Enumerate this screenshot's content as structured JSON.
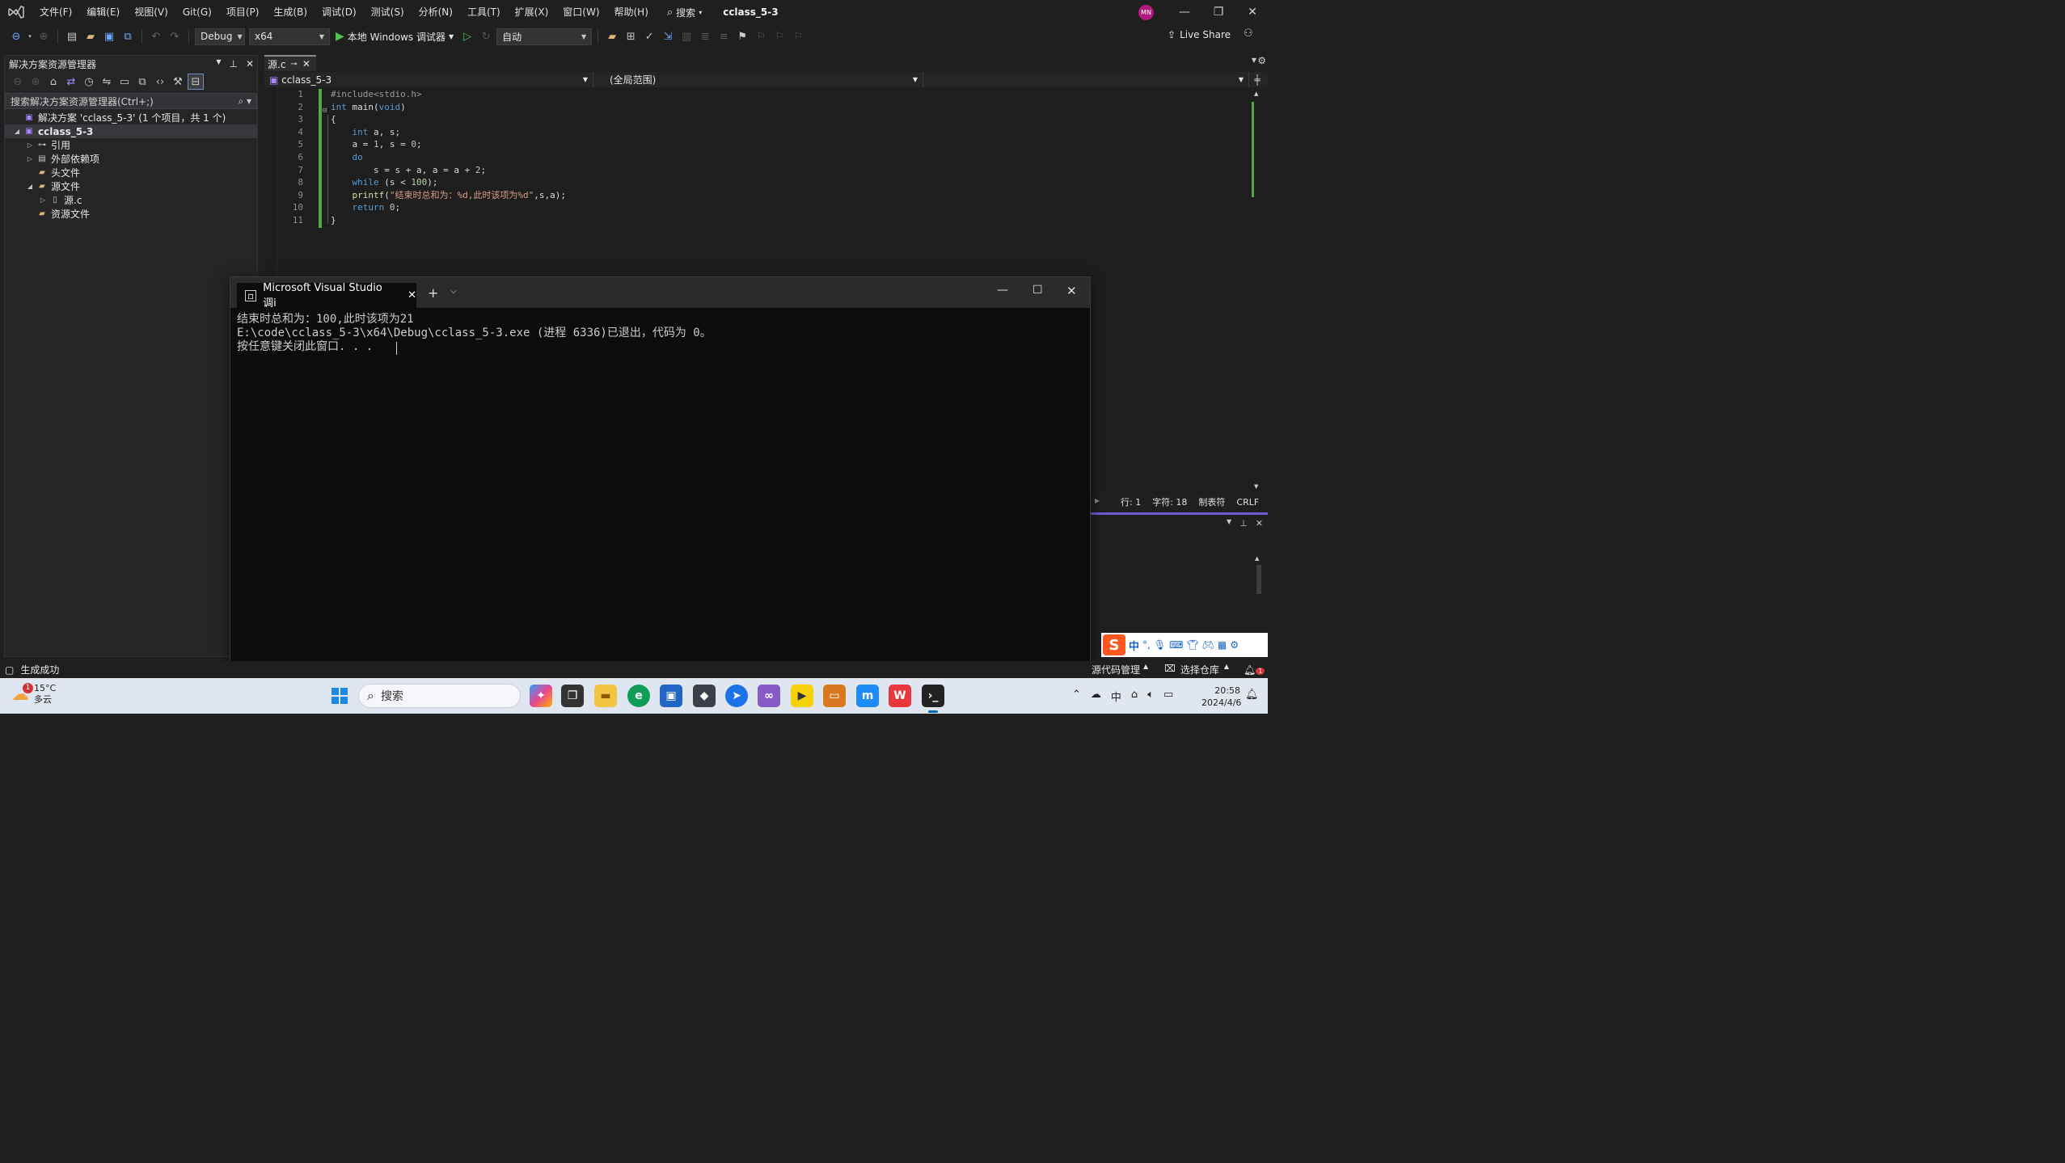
{
  "titlebar": {
    "menus": [
      "文件(F)",
      "编辑(E)",
      "视图(V)",
      "Git(G)",
      "项目(P)",
      "生成(B)",
      "调试(D)",
      "测试(S)",
      "分析(N)",
      "工具(T)",
      "扩展(X)",
      "窗口(W)",
      "帮助(H)"
    ],
    "search_label": "搜索",
    "solution_name": "cclass_5-3",
    "avatar_initials": "MN",
    "avatar_color": "#b0197e"
  },
  "toolbar": {
    "config": "Debug",
    "platform": "x64",
    "run_label": "本地 Windows 调试器",
    "auto": "自动",
    "live_share": "Live Share",
    "run_color": "#4ec24e"
  },
  "explorer": {
    "title": "解决方案资源管理器",
    "search_placeholder": "搜索解决方案资源管理器(Ctrl+;)",
    "tree": [
      {
        "label": "解决方案 'cclass_5-3' (1 个项目，共 1 个)",
        "level": 0,
        "expander": "",
        "icon": "solution-icon"
      },
      {
        "label": "cclass_5-3",
        "level": 0,
        "expander": "◢",
        "icon": "project-icon",
        "bold": true,
        "selected": true
      },
      {
        "label": "引用",
        "level": 1,
        "expander": "▷",
        "icon": "references-icon"
      },
      {
        "label": "外部依赖项",
        "level": 1,
        "expander": "▷",
        "icon": "external-deps-icon"
      },
      {
        "label": "头文件",
        "level": 1,
        "expander": "",
        "icon": "folder-icon"
      },
      {
        "label": "源文件",
        "level": 1,
        "expander": "◢",
        "icon": "folder-icon"
      },
      {
        "label": "源.c",
        "level": 2,
        "expander": "▷",
        "icon": "c-file-icon"
      },
      {
        "label": "资源文件",
        "level": 1,
        "expander": "",
        "icon": "folder-icon"
      }
    ]
  },
  "editor": {
    "tab_name": "源.c",
    "nav_project": "cclass_5-3",
    "nav_scope": "(全局范围)",
    "lines": [
      {
        "n": "1",
        "parts": [
          {
            "c": "pp",
            "t": "#include<stdio.h>"
          }
        ]
      },
      {
        "n": "2",
        "parts": [
          {
            "c": "kw",
            "t": "int"
          },
          {
            "c": "txt",
            "t": " main("
          },
          {
            "c": "kw",
            "t": "void"
          },
          {
            "c": "txt",
            "t": ")"
          }
        ]
      },
      {
        "n": "3",
        "parts": [
          {
            "c": "txt",
            "t": "{"
          }
        ]
      },
      {
        "n": "4",
        "parts": [
          {
            "c": "txt",
            "t": "    "
          },
          {
            "c": "kw",
            "t": "int"
          },
          {
            "c": "txt",
            "t": " a, s;"
          }
        ]
      },
      {
        "n": "5",
        "parts": [
          {
            "c": "txt",
            "t": "    a = "
          },
          {
            "c": "num",
            "t": "1"
          },
          {
            "c": "txt",
            "t": ", s = "
          },
          {
            "c": "num",
            "t": "0"
          },
          {
            "c": "txt",
            "t": ";"
          }
        ]
      },
      {
        "n": "6",
        "parts": [
          {
            "c": "txt",
            "t": "    "
          },
          {
            "c": "kw",
            "t": "do"
          }
        ]
      },
      {
        "n": "7",
        "parts": [
          {
            "c": "txt",
            "t": "        s = s + a, a = a + "
          },
          {
            "c": "num",
            "t": "2"
          },
          {
            "c": "txt",
            "t": ";"
          }
        ]
      },
      {
        "n": "8",
        "parts": [
          {
            "c": "txt",
            "t": "    "
          },
          {
            "c": "kw",
            "t": "while"
          },
          {
            "c": "txt",
            "t": " (s < "
          },
          {
            "c": "num",
            "t": "100"
          },
          {
            "c": "txt",
            "t": ");"
          }
        ]
      },
      {
        "n": "9",
        "parts": [
          {
            "c": "txt",
            "t": "    "
          },
          {
            "c": "fn",
            "t": "printf"
          },
          {
            "c": "txt",
            "t": "("
          },
          {
            "c": "str",
            "t": "\"结束时总和为：%d,此时该项为%d\""
          },
          {
            "c": "txt",
            "t": ",s,a);"
          }
        ]
      },
      {
        "n": "10",
        "parts": [
          {
            "c": "txt",
            "t": "    "
          },
          {
            "c": "kw",
            "t": "return"
          },
          {
            "c": "txt",
            "t": " "
          },
          {
            "c": "num",
            "t": "0"
          },
          {
            "c": "txt",
            "t": ";"
          }
        ]
      },
      {
        "n": "11",
        "parts": [
          {
            "c": "txt",
            "t": "}"
          }
        ]
      }
    ],
    "status": {
      "line": "行: 1",
      "char": "字符: 18",
      "tabs": "制表符",
      "eol": "CRLF"
    }
  },
  "console": {
    "title": "Microsoft Visual Studio 调i",
    "lines": [
      "结束时总和为：100,此时该项为21",
      "E:\\code\\cclass_5-3\\x64\\Debug\\cclass_5-3.exe (进程 6336)已退出，代码为 0。",
      "按任意键关闭此窗口. . ."
    ]
  },
  "statusbar": {
    "build": "生成成功",
    "source_control": "源代码管理",
    "select_repo": "选择仓库",
    "notify_count": "1"
  },
  "ime": {
    "brand": "S",
    "mode": "中"
  },
  "taskbar": {
    "weather_temp": "15°C",
    "weather_desc": "多云",
    "weather_badge": "1",
    "search": "搜索",
    "time": "20:58",
    "date": "2024/4/6",
    "tray_ime": "中"
  }
}
